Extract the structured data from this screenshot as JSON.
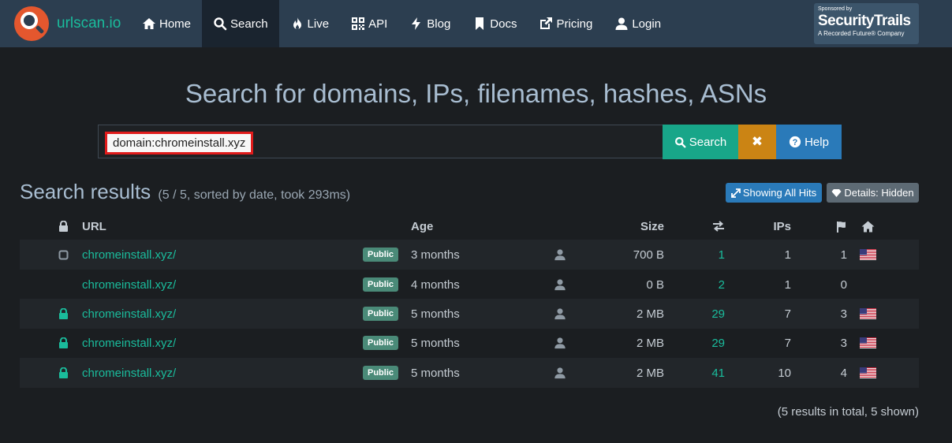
{
  "brand": {
    "name": "urlscan.io"
  },
  "nav": [
    {
      "label": "Home",
      "icon": "home-icon"
    },
    {
      "label": "Search",
      "icon": "search-icon",
      "active": true
    },
    {
      "label": "Live",
      "icon": "fire-icon"
    },
    {
      "label": "API",
      "icon": "qrcode-icon"
    },
    {
      "label": "Blog",
      "icon": "bolt-icon"
    },
    {
      "label": "Docs",
      "icon": "bookmark-icon"
    },
    {
      "label": "Pricing",
      "icon": "external-link-icon"
    },
    {
      "label": "Login",
      "icon": "user-icon"
    }
  ],
  "sponsor": {
    "line1": "Sponsored by",
    "line2": "SecurityTrails",
    "line3": "A Recorded Future® Company"
  },
  "hero": {
    "title": "Search for domains, IPs, filenames, hashes, ASNs"
  },
  "search": {
    "value": "domain:chromeinstall.xyz",
    "search_label": "Search",
    "clear_label": "✖",
    "help_label": "Help"
  },
  "results": {
    "title": "Search results",
    "meta": "(5 / 5, sorted by date, took 293ms)",
    "hits_label": "Showing All Hits",
    "details_label": "Details: Hidden"
  },
  "table": {
    "headers": {
      "url": "URL",
      "age": "Age",
      "size": "Size",
      "ips": "IPs"
    },
    "rows": [
      {
        "lock": "square",
        "url": "chromeinstall.xyz/",
        "badge": "Public",
        "age": "3 months",
        "size": "700 B",
        "requests": "1",
        "ips": "1",
        "countries": "1",
        "flag": "us"
      },
      {
        "lock": "none",
        "url": "chromeinstall.xyz/",
        "badge": "Public",
        "age": "4 months",
        "size": "0 B",
        "requests": "2",
        "ips": "1",
        "countries": "0",
        "flag": "none"
      },
      {
        "lock": "lock",
        "url": "chromeinstall.xyz/",
        "badge": "Public",
        "age": "5 months",
        "size": "2 MB",
        "requests": "29",
        "ips": "7",
        "countries": "3",
        "flag": "us"
      },
      {
        "lock": "lock",
        "url": "chromeinstall.xyz/",
        "badge": "Public",
        "age": "5 months",
        "size": "2 MB",
        "requests": "29",
        "ips": "7",
        "countries": "3",
        "flag": "us"
      },
      {
        "lock": "lock",
        "url": "chromeinstall.xyz/",
        "badge": "Public",
        "age": "5 months",
        "size": "2 MB",
        "requests": "41",
        "ips": "10",
        "countries": "4",
        "flag": "us"
      }
    ]
  },
  "footer": {
    "note": "(5 results in total, 5 shown)"
  },
  "colors": {
    "accent": "#1abc9c",
    "navbar": "#2c3e50",
    "background": "#1b1e21",
    "highlight": "#e01b1b"
  }
}
